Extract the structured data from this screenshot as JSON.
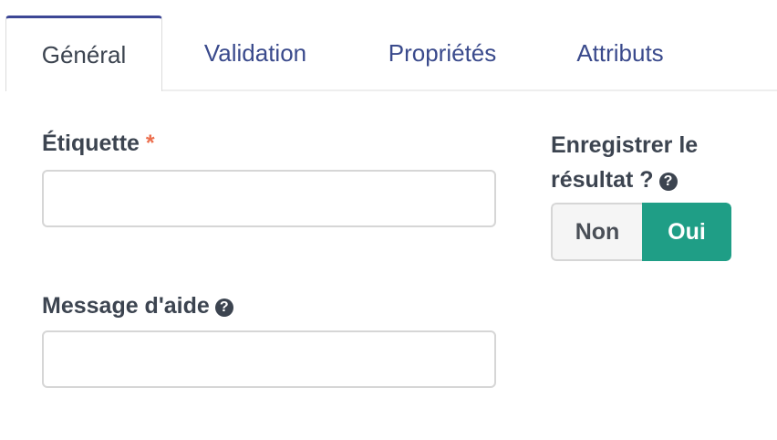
{
  "tabs": {
    "general": "Général",
    "validation": "Validation",
    "proprietes": "Propriétés",
    "attributs": "Attributs"
  },
  "form": {
    "etiquette_label": "Étiquette",
    "required_mark": "*",
    "etiquette_value": "",
    "message_aide_label": "Message d'aide",
    "message_aide_value": "",
    "enregistrer_label_line1": "Enregistrer le",
    "enregistrer_label_line2": "résultat ?",
    "toggle_off_label": "Non",
    "toggle_on_label": "Oui",
    "toggle_selected": "Oui"
  },
  "icons": {
    "help": "question-circle-icon"
  },
  "colors": {
    "active_tab_border": "#3d4795",
    "tab_text": "#3a4a8c",
    "required": "#ec6f4e",
    "toggle_on": "#1f9e86"
  }
}
